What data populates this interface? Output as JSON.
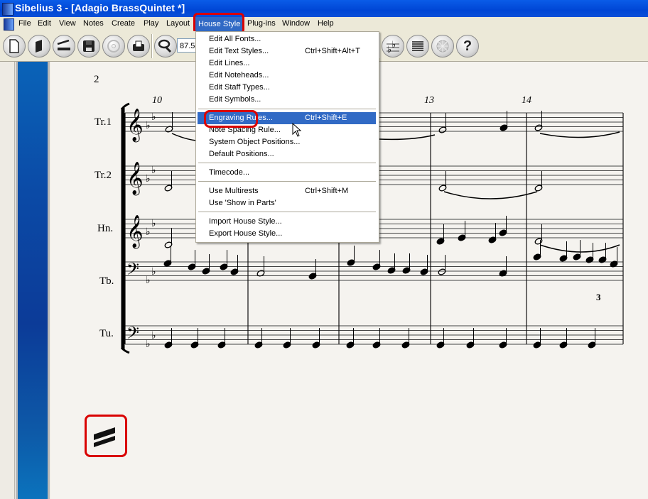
{
  "window": {
    "title": "Sibelius 3 - [Adagio BrassQuintet *]"
  },
  "menubar": {
    "items": [
      "File",
      "Edit",
      "View",
      "Notes",
      "Create",
      "Play",
      "Layout",
      "House Style",
      "Plug-ins",
      "Window",
      "Help"
    ],
    "active": "House Style"
  },
  "toolbar": {
    "buttons": [
      "new-icon",
      "open-icon",
      "scan-icon",
      "save-icon",
      "cd-icon",
      "print-icon",
      "zoom-icon"
    ],
    "zoom_value": "87.5",
    "right_buttons": [
      "keysig-icon",
      "staff-icon",
      "navigator-icon",
      "help-icon"
    ],
    "help_glyph": "?"
  },
  "house_style_menu": {
    "groups": [
      [
        {
          "label": "Edit All Fonts...",
          "shortcut": ""
        },
        {
          "label": "Edit Text Styles...",
          "shortcut": "Ctrl+Shift+Alt+T"
        },
        {
          "label": "Edit Lines...",
          "shortcut": ""
        },
        {
          "label": "Edit Noteheads...",
          "shortcut": ""
        },
        {
          "label": "Edit Staff Types...",
          "shortcut": ""
        },
        {
          "label": "Edit Symbols...",
          "shortcut": ""
        }
      ],
      [
        {
          "label": "Engraving Rules...",
          "shortcut": "Ctrl+Shift+E",
          "highlighted": true
        },
        {
          "label": "Note Spacing Rule...",
          "shortcut": ""
        },
        {
          "label": "System Object Positions...",
          "shortcut": ""
        },
        {
          "label": "Default Positions...",
          "shortcut": ""
        }
      ],
      [
        {
          "label": "Timecode...",
          "shortcut": ""
        }
      ],
      [
        {
          "label": "Use Multirests",
          "shortcut": "Ctrl+Shift+M"
        },
        {
          "label": "Use 'Show in Parts'",
          "shortcut": ""
        }
      ],
      [
        {
          "label": "Import House Style...",
          "shortcut": ""
        },
        {
          "label": "Export House Style...",
          "shortcut": ""
        }
      ]
    ]
  },
  "score": {
    "page_number": "2",
    "bar_numbers": [
      "10",
      "13",
      "14"
    ],
    "staves": [
      "Tr.1",
      "Tr.2",
      "Hn.",
      "Tb.",
      "Tu."
    ],
    "tuplet_number": "3",
    "key_signature": "B-flat major (2 flats)"
  },
  "highlight_colors": {
    "annotation_red": "#d90000",
    "menu_highlight": "#316ac5",
    "title_blue": "#0046d5"
  },
  "annotation_icon": "double-slash-tremolo-icon"
}
